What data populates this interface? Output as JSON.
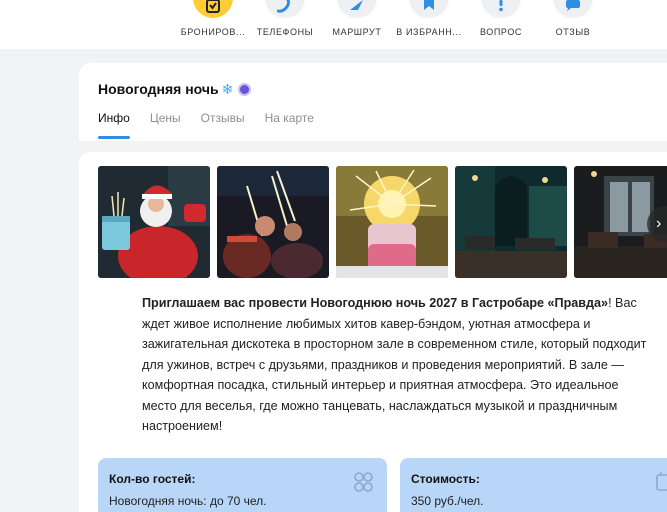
{
  "actions": [
    {
      "label": "БРОНИРОВ...",
      "icon": "booking-icon"
    },
    {
      "label": "ТЕЛЕФОНЫ",
      "icon": "phone-icon"
    },
    {
      "label": "МАРШРУТ",
      "icon": "route-icon"
    },
    {
      "label": "В ИЗБРАНН...",
      "icon": "bookmark-icon"
    },
    {
      "label": "ВОПРОС",
      "icon": "question-icon"
    },
    {
      "label": "ОТЗЫВ",
      "icon": "review-icon"
    }
  ],
  "header": {
    "title": "Новогодняя ночь",
    "title_emoji": "❄",
    "tabs": [
      "Инфо",
      "Цены",
      "Отзывы",
      "На карте"
    ],
    "active_tab": "Инфо"
  },
  "description": {
    "lead": "Приглашаем вас провести Новогоднюю ночь 2027 в Гастробаре «Правда»",
    "lead_end": "!",
    "body": " Вас ждет живое исполнение любимых хитов кавер-бэндом, уютная атмосфера и зажигательная дискотека в просторном зале в современном стиле, который подходит для ужинов, встреч с друзьями, праздников и проведения мероприятий. В зале — комфортная посадка, стильный интерьер и приятная атмосфера. Это идеальное место для веселья, где можно танцевать, наслаждаться музыкой и праздничным настроением!"
  },
  "info": {
    "guests": {
      "title": "Кол-во гостей:",
      "value": "Новогодняя ночь: до 70 чел."
    },
    "price": {
      "title": "Стоимость:",
      "value": "350 руб./чел."
    }
  },
  "colors": {
    "accent": "#2d8ee6",
    "primary_action": "#ffcc33",
    "info_box": "#b8d7f8"
  }
}
